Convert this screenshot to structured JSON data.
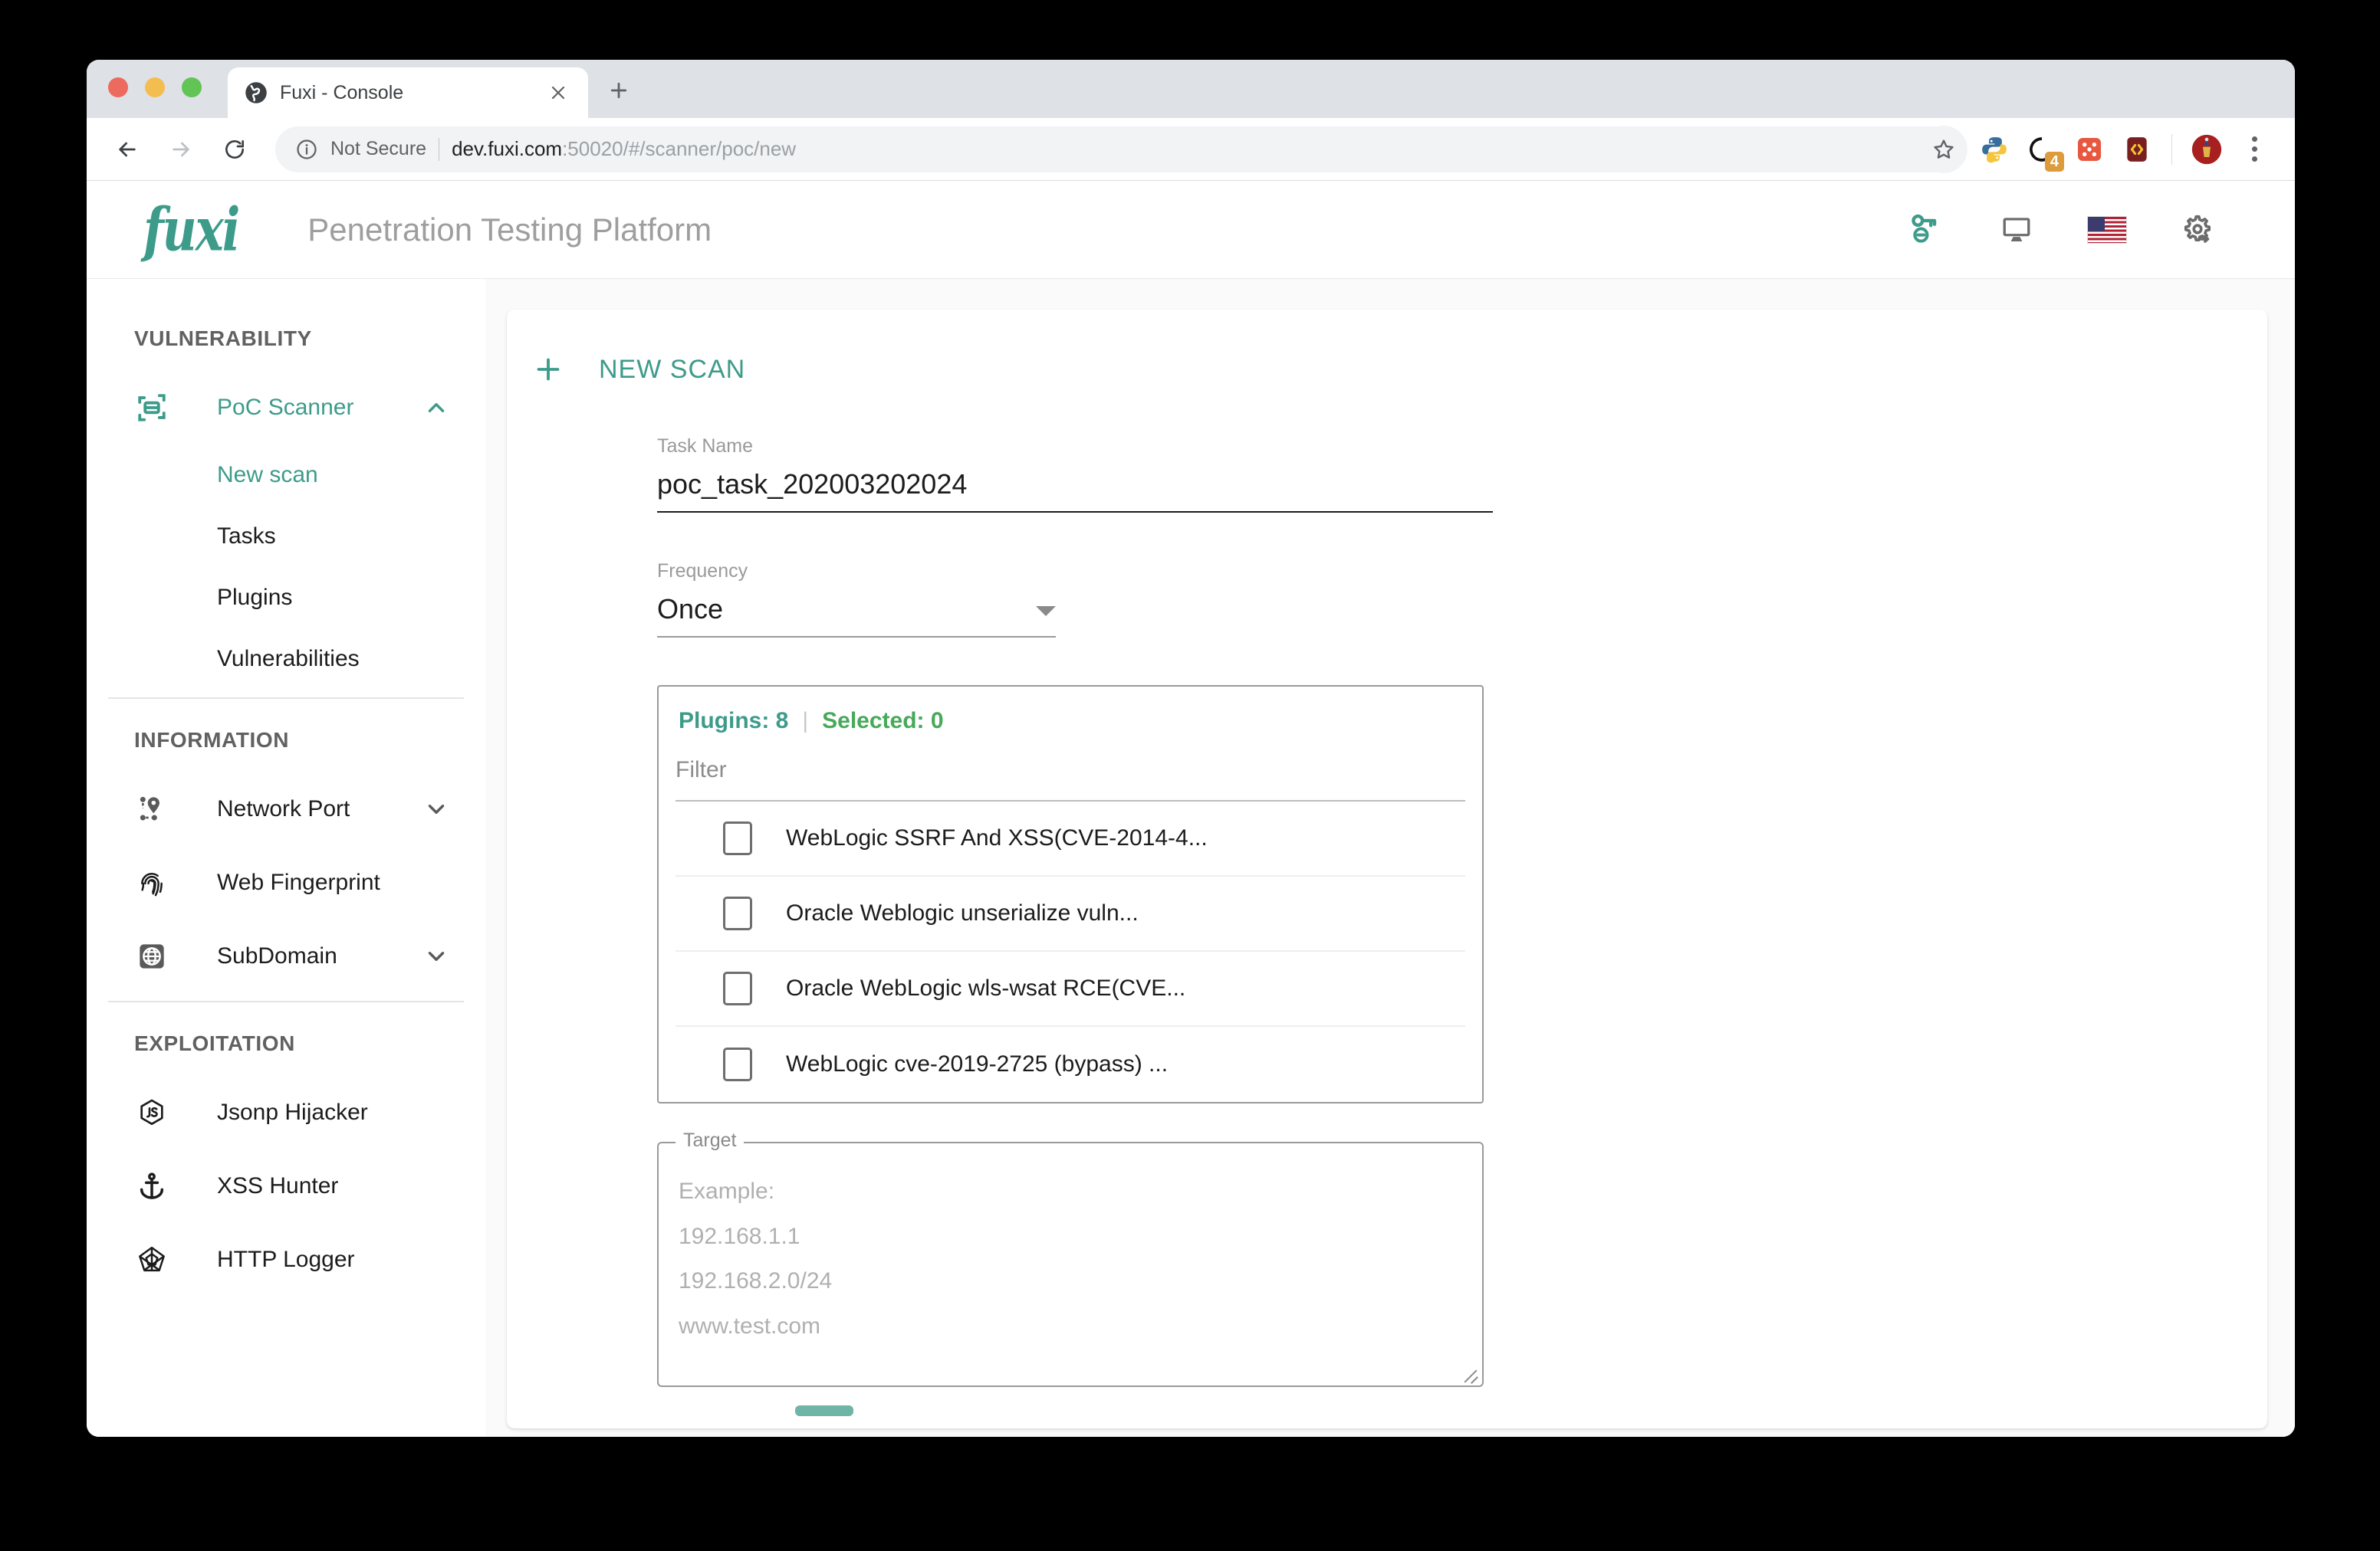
{
  "browser": {
    "tab": {
      "title": "Fuxi - Console",
      "favicon_icon": "globe-icon",
      "close_icon": "close-icon"
    },
    "new_tab_label": "+",
    "nav": {
      "back_icon": "back-arrow-icon",
      "forward_icon": "forward-arrow-icon",
      "reload_icon": "reload-icon"
    },
    "omnibox": {
      "info_icon": "info-circle-icon",
      "security_label": "Not Secure",
      "url_host": "dev.fuxi.com",
      "url_rest": ":50020/#/scanner/poc/new"
    },
    "bookmark_icon": "star-icon",
    "extensions": [
      {
        "name": "python-extension-icon"
      },
      {
        "name": "quickcheck-extension-icon",
        "badge": "4"
      },
      {
        "name": "dice-extension-icon"
      },
      {
        "name": "code-brackets-extension-icon"
      }
    ],
    "avatar_icon": "profile-avatar-icon",
    "menu_icon": "kebab-menu-icon"
  },
  "app": {
    "logo_text": "fuxi",
    "title": "Penetration Testing Platform",
    "header_icons": [
      {
        "name": "key-link-icon"
      },
      {
        "name": "monitor-icon"
      },
      {
        "name": "us-flag-icon"
      },
      {
        "name": "settings-gear-icon"
      }
    ]
  },
  "sidebar": {
    "sections": [
      {
        "title": "VULNERABILITY",
        "items": [
          {
            "label": "PoC Scanner",
            "icon": "scan-frame-icon",
            "active": true,
            "expanded": true,
            "chevron": "chevron-up-icon",
            "children": [
              {
                "label": "New scan",
                "active": true
              },
              {
                "label": "Tasks",
                "active": false
              },
              {
                "label": "Plugins",
                "active": false
              },
              {
                "label": "Vulnerabilities",
                "active": false
              }
            ]
          }
        ]
      },
      {
        "title": "INFORMATION",
        "items": [
          {
            "label": "Network Port",
            "icon": "network-nodes-icon",
            "chevron": "chevron-down-icon"
          },
          {
            "label": "Web Fingerprint",
            "icon": "fingerprint-icon",
            "chevron": ""
          },
          {
            "label": "SubDomain",
            "icon": "globe-square-icon",
            "chevron": "chevron-down-icon"
          }
        ]
      },
      {
        "title": "EXPLOITATION",
        "items": [
          {
            "label": "Jsonp Hijacker",
            "icon": "js-hexagon-icon",
            "chevron": ""
          },
          {
            "label": "XSS Hunter",
            "icon": "anchor-icon",
            "chevron": ""
          },
          {
            "label": "HTTP Logger",
            "icon": "spider-web-icon",
            "chevron": ""
          }
        ]
      }
    ]
  },
  "main": {
    "card_title": "NEW SCAN",
    "add_icon": "plus-icon",
    "task_name": {
      "label": "Task Name",
      "value": "poc_task_202003202024"
    },
    "frequency": {
      "label": "Frequency",
      "value": "Once",
      "caret_icon": "dropdown-caret-icon"
    },
    "plugins_panel": {
      "count_label": "Plugins: 8",
      "divider": "|",
      "selected_label": "Selected: 0",
      "filter_placeholder": "Filter",
      "rows": [
        {
          "name": "WebLogic SSRF And XSS(CVE-2014-4...",
          "checked": false
        },
        {
          "name": "Oracle Weblogic unserialize vuln...",
          "checked": false
        },
        {
          "name": "Oracle WebLogic wls-wsat RCE(CVE...",
          "checked": false
        },
        {
          "name": "WebLogic cve-2019-2725 (bypass) ...",
          "checked": false
        }
      ]
    },
    "target": {
      "legend": "Target",
      "placeholder_lines": [
        "Example:",
        "192.168.1.1",
        "192.168.2.0/24",
        "www.test.com"
      ],
      "resize_icon": "resize-handle-icon"
    }
  },
  "colors": {
    "accent_teal": "#3d9b8a",
    "selected_green": "#47a95a",
    "page_bg": "#fafafa",
    "muted_text": "#9e9e9e"
  }
}
